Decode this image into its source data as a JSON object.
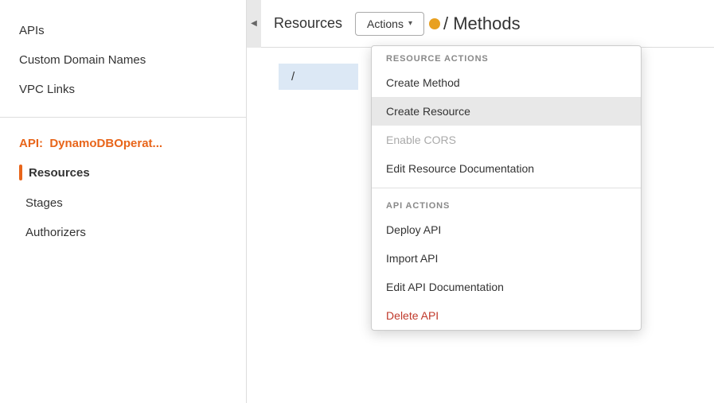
{
  "sidebar": {
    "nav_items": [
      {
        "label": "APIs"
      },
      {
        "label": "Custom Domain Names"
      },
      {
        "label": "VPC Links"
      }
    ],
    "api_label_prefix": "API:",
    "api_name": "DynamoDBOperat...",
    "section_item": "Resources",
    "sub_items": [
      {
        "label": "Stages"
      },
      {
        "label": "Authorizers"
      }
    ]
  },
  "header": {
    "resources_label": "Resources",
    "actions_button": "Actions",
    "methods_title": "/ Methods",
    "collapse_icon": "◀"
  },
  "resource_row": {
    "path": "/"
  },
  "dropdown": {
    "resource_actions_label": "RESOURCE ACTIONS",
    "items_resource": [
      {
        "label": "Create Method",
        "state": "normal"
      },
      {
        "label": "Create Resource",
        "state": "active"
      },
      {
        "label": "Enable CORS",
        "state": "disabled"
      },
      {
        "label": "Edit Resource Documentation",
        "state": "normal"
      }
    ],
    "api_actions_label": "API ACTIONS",
    "items_api": [
      {
        "label": "Deploy API",
        "state": "normal"
      },
      {
        "label": "Import API",
        "state": "normal"
      },
      {
        "label": "Edit API Documentation",
        "state": "normal"
      },
      {
        "label": "Delete API",
        "state": "danger"
      }
    ]
  }
}
